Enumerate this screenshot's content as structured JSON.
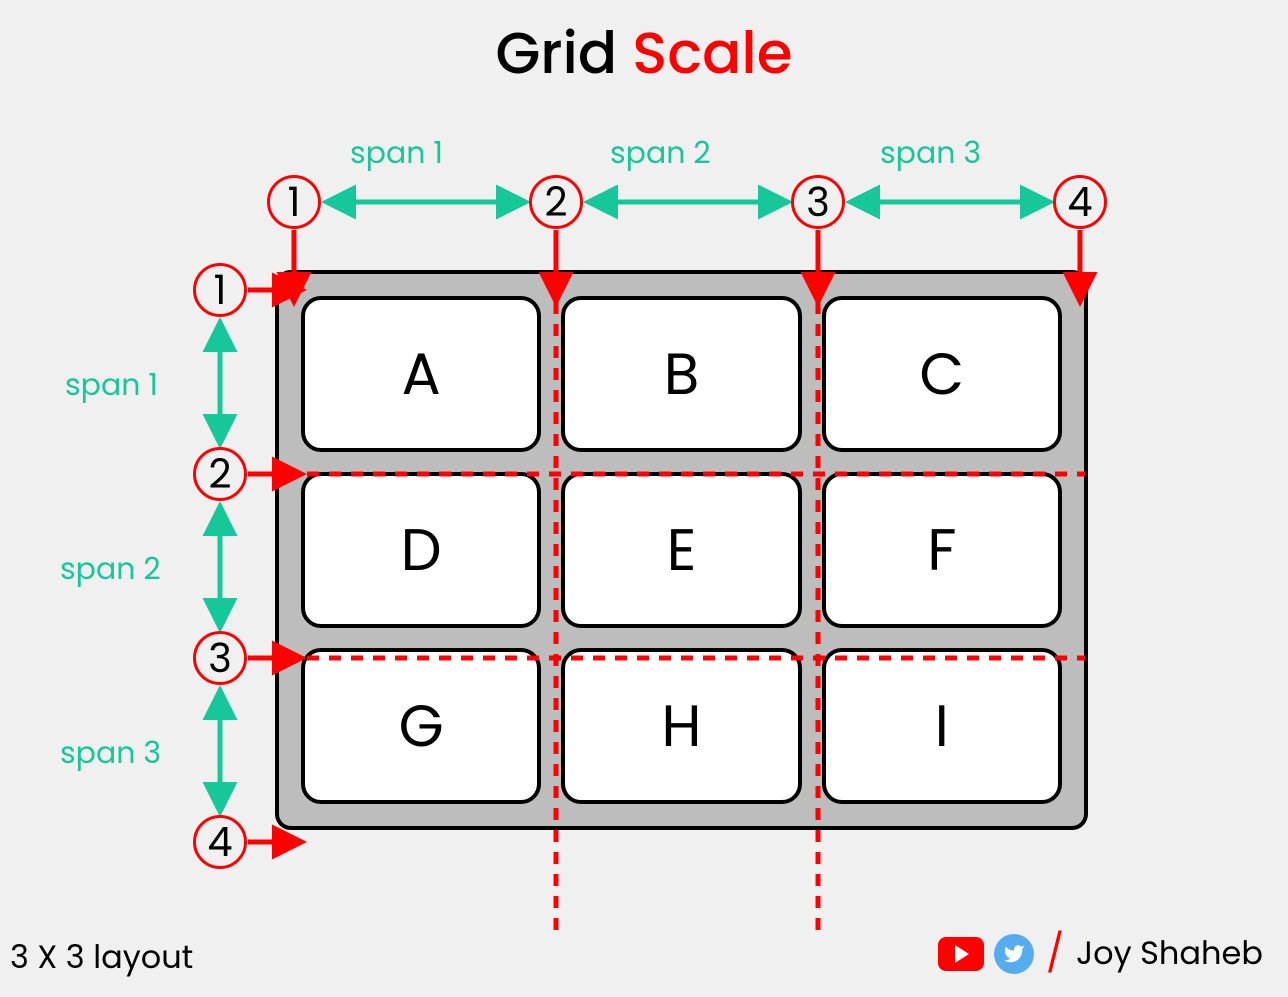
{
  "title": {
    "part1": "Grid ",
    "part2": "Scale"
  },
  "colors": {
    "accent_red": "#ff0000",
    "accent_teal": "#16c79a",
    "grid_bg": "#bdbdbd",
    "twitter_blue": "#55acee"
  },
  "columns": {
    "spans": [
      "span 1",
      "span 2",
      "span 3"
    ],
    "scales": [
      "1",
      "2",
      "3",
      "4"
    ]
  },
  "rows": {
    "spans": [
      "span 1",
      "span 2",
      "span 3"
    ],
    "scales": [
      "1",
      "2",
      "3",
      "4"
    ]
  },
  "cells": [
    "A",
    "B",
    "C",
    "D",
    "E",
    "F",
    "G",
    "H",
    "I"
  ],
  "footer": {
    "layout_note": "3 X 3 layout",
    "author": "Joy Shaheb"
  },
  "icons": {
    "youtube": "youtube-icon",
    "twitter": "twitter-icon"
  }
}
